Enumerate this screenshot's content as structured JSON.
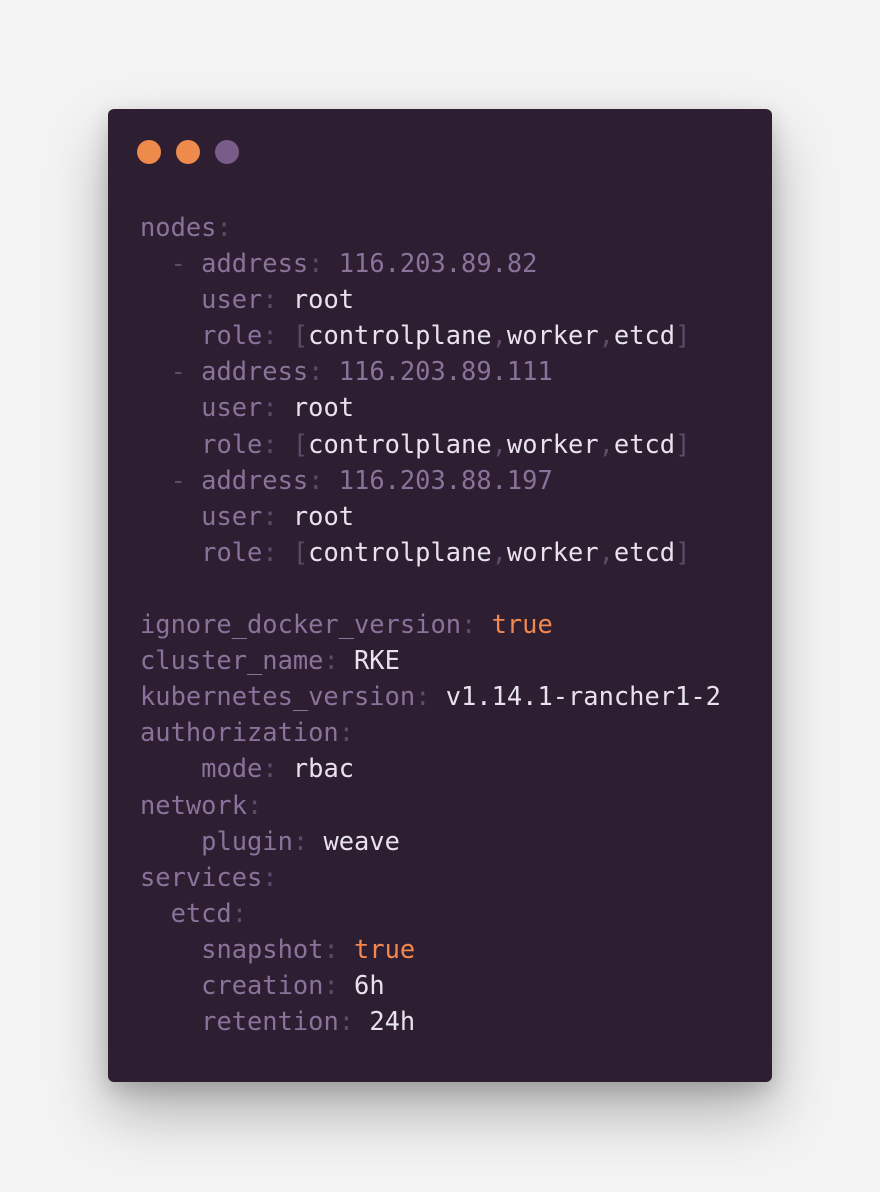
{
  "window": {
    "dots": [
      {
        "name": "close-dot",
        "color": "#ef8a4d"
      },
      {
        "name": "minimize-dot",
        "color": "#ef8a4d"
      },
      {
        "name": "zoom-dot",
        "color": "#7a5c8a"
      }
    ]
  },
  "colors": {
    "background": "#f4f3f4",
    "window": "#2d1e31",
    "key": "#8a729a",
    "punctuation": "#5e4b68",
    "value": "#e8e2ec",
    "boolean": "#f2884f"
  },
  "code": {
    "lines": [
      [
        {
          "t": "nodes",
          "c": "key"
        },
        {
          "t": ":",
          "c": "punct"
        }
      ],
      [
        {
          "t": "  - ",
          "c": "punct"
        },
        {
          "t": "address",
          "c": "key"
        },
        {
          "t": ": ",
          "c": "punct"
        },
        {
          "t": "116.203.89.82",
          "c": "key"
        }
      ],
      [
        {
          "t": "    ",
          "c": "punct"
        },
        {
          "t": "user",
          "c": "key"
        },
        {
          "t": ": ",
          "c": "punct"
        },
        {
          "t": "root",
          "c": "val"
        }
      ],
      [
        {
          "t": "    ",
          "c": "punct"
        },
        {
          "t": "role",
          "c": "key"
        },
        {
          "t": ": [",
          "c": "punct"
        },
        {
          "t": "controlplane",
          "c": "val"
        },
        {
          "t": ",",
          "c": "punct"
        },
        {
          "t": "worker",
          "c": "val"
        },
        {
          "t": ",",
          "c": "punct"
        },
        {
          "t": "etcd",
          "c": "val"
        },
        {
          "t": "]",
          "c": "punct"
        }
      ],
      [
        {
          "t": "  - ",
          "c": "punct"
        },
        {
          "t": "address",
          "c": "key"
        },
        {
          "t": ": ",
          "c": "punct"
        },
        {
          "t": "116.203.89.111",
          "c": "key"
        }
      ],
      [
        {
          "t": "    ",
          "c": "punct"
        },
        {
          "t": "user",
          "c": "key"
        },
        {
          "t": ": ",
          "c": "punct"
        },
        {
          "t": "root",
          "c": "val"
        }
      ],
      [
        {
          "t": "    ",
          "c": "punct"
        },
        {
          "t": "role",
          "c": "key"
        },
        {
          "t": ": [",
          "c": "punct"
        },
        {
          "t": "controlplane",
          "c": "val"
        },
        {
          "t": ",",
          "c": "punct"
        },
        {
          "t": "worker",
          "c": "val"
        },
        {
          "t": ",",
          "c": "punct"
        },
        {
          "t": "etcd",
          "c": "val"
        },
        {
          "t": "]",
          "c": "punct"
        }
      ],
      [
        {
          "t": "  - ",
          "c": "punct"
        },
        {
          "t": "address",
          "c": "key"
        },
        {
          "t": ": ",
          "c": "punct"
        },
        {
          "t": "116.203.88.197",
          "c": "key"
        }
      ],
      [
        {
          "t": "    ",
          "c": "punct"
        },
        {
          "t": "user",
          "c": "key"
        },
        {
          "t": ": ",
          "c": "punct"
        },
        {
          "t": "root",
          "c": "val"
        }
      ],
      [
        {
          "t": "    ",
          "c": "punct"
        },
        {
          "t": "role",
          "c": "key"
        },
        {
          "t": ": [",
          "c": "punct"
        },
        {
          "t": "controlplane",
          "c": "val"
        },
        {
          "t": ",",
          "c": "punct"
        },
        {
          "t": "worker",
          "c": "val"
        },
        {
          "t": ",",
          "c": "punct"
        },
        {
          "t": "etcd",
          "c": "val"
        },
        {
          "t": "]",
          "c": "punct"
        }
      ],
      [],
      [
        {
          "t": "ignore_docker_version",
          "c": "key"
        },
        {
          "t": ": ",
          "c": "punct"
        },
        {
          "t": "true",
          "c": "bool"
        }
      ],
      [
        {
          "t": "cluster_name",
          "c": "key"
        },
        {
          "t": ": ",
          "c": "punct"
        },
        {
          "t": "RKE",
          "c": "val"
        }
      ],
      [
        {
          "t": "kubernetes_version",
          "c": "key"
        },
        {
          "t": ": ",
          "c": "punct"
        },
        {
          "t": "v1.14.1-rancher1-2",
          "c": "val"
        }
      ],
      [
        {
          "t": "authorization",
          "c": "key"
        },
        {
          "t": ":",
          "c": "punct"
        }
      ],
      [
        {
          "t": "    ",
          "c": "punct"
        },
        {
          "t": "mode",
          "c": "key"
        },
        {
          "t": ": ",
          "c": "punct"
        },
        {
          "t": "rbac",
          "c": "val"
        }
      ],
      [
        {
          "t": "network",
          "c": "key"
        },
        {
          "t": ":",
          "c": "punct"
        }
      ],
      [
        {
          "t": "    ",
          "c": "punct"
        },
        {
          "t": "plugin",
          "c": "key"
        },
        {
          "t": ": ",
          "c": "punct"
        },
        {
          "t": "weave",
          "c": "val"
        }
      ],
      [
        {
          "t": "services",
          "c": "key"
        },
        {
          "t": ":",
          "c": "punct"
        }
      ],
      [
        {
          "t": "  ",
          "c": "punct"
        },
        {
          "t": "etcd",
          "c": "key"
        },
        {
          "t": ":",
          "c": "punct"
        }
      ],
      [
        {
          "t": "    ",
          "c": "punct"
        },
        {
          "t": "snapshot",
          "c": "key"
        },
        {
          "t": ": ",
          "c": "punct"
        },
        {
          "t": "true",
          "c": "bool"
        }
      ],
      [
        {
          "t": "    ",
          "c": "punct"
        },
        {
          "t": "creation",
          "c": "key"
        },
        {
          "t": ": ",
          "c": "punct"
        },
        {
          "t": "6h",
          "c": "val"
        }
      ],
      [
        {
          "t": "    ",
          "c": "punct"
        },
        {
          "t": "retention",
          "c": "key"
        },
        {
          "t": ": ",
          "c": "punct"
        },
        {
          "t": "24h",
          "c": "val"
        }
      ]
    ]
  }
}
